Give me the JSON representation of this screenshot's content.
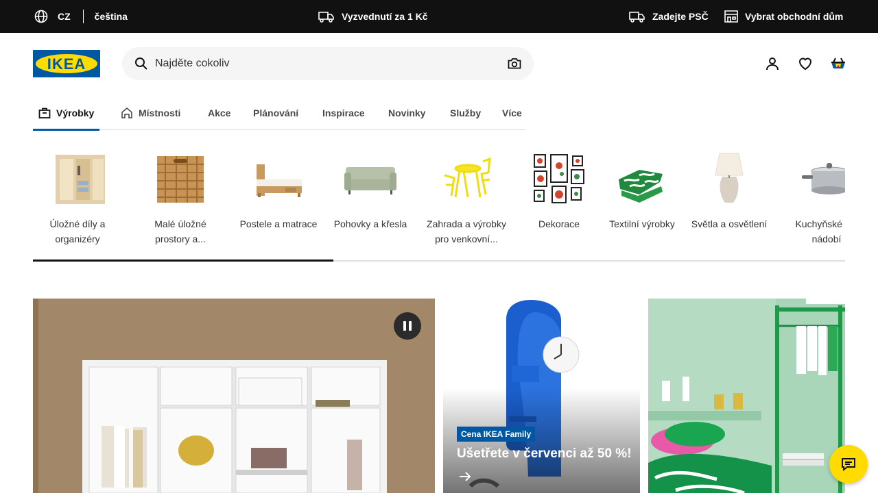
{
  "topbar": {
    "lang_code": "CZ",
    "lang_name": "čeština",
    "pickup": "Vyzvednutí za 1 Kč",
    "postcode": "Zadejte PSČ",
    "store": "Vybrat obchodní dům"
  },
  "header": {
    "logo_text": "IKEA",
    "search_placeholder": "Najděte cokoliv"
  },
  "nav": {
    "tabs": [
      {
        "label": "Výrobky",
        "icon": "bag-icon",
        "active": true
      },
      {
        "label": "Místnosti",
        "icon": "house-icon",
        "active": false
      },
      {
        "label": "Akce",
        "active": false
      },
      {
        "label": "Plánování",
        "active": false
      },
      {
        "label": "Inspirace",
        "active": false
      },
      {
        "label": "Novinky",
        "active": false
      },
      {
        "label": "Služby",
        "active": false
      },
      {
        "label": "Více",
        "active": false
      }
    ]
  },
  "categories": [
    {
      "line1": "Úložné díly a",
      "line2": "organizéry"
    },
    {
      "line1": "Malé úložné",
      "line2": "prostory a..."
    },
    {
      "line1": "Postele a matrace",
      "line2": ""
    },
    {
      "line1": "Pohovky a křesla",
      "line2": ""
    },
    {
      "line1": "Zahrada a výrobky",
      "line2": "pro venkovní..."
    },
    {
      "line1": "Dekorace",
      "line2": ""
    },
    {
      "line1": "Textilní výrobky",
      "line2": ""
    },
    {
      "line1": "Světla a osvětlení",
      "line2": ""
    },
    {
      "line1": "Kuchyňské a s",
      "line2": "nádobí"
    }
  ],
  "scroll_progress": 0.37,
  "promo": {
    "badge": "Cena IKEA Family",
    "headline": "Ušetřete v červenci až 50 %!"
  },
  "colors": {
    "brand_blue": "#0058a3",
    "brand_yellow": "#ffdb00",
    "topbar_bg": "#111111"
  }
}
